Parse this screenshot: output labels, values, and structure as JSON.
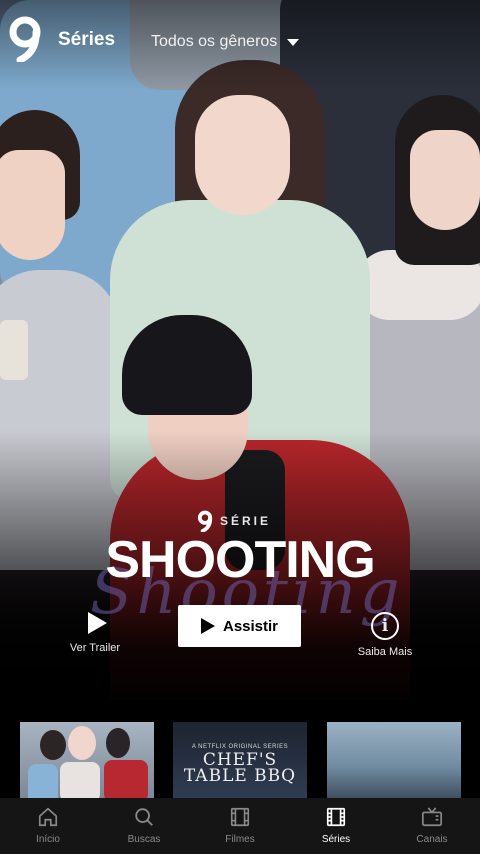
{
  "header": {
    "section_title": "Séries",
    "genre_filter": "Todos os gêneros"
  },
  "featured": {
    "tag": "SÉRIE",
    "title": "SHOOTING",
    "actions": {
      "trailer_label": "Ver Trailer",
      "watch_label": "Assistir",
      "info_label": "Saiba Mais"
    }
  },
  "thumbnails": [
    {
      "caption_small": "",
      "caption_big": ""
    },
    {
      "caption_small": "A NETFLIX ORIGINAL SERIES",
      "caption_big": "CHEF'S TABLE BBQ"
    },
    {
      "caption_small": "",
      "caption_big": ""
    }
  ],
  "nav": {
    "items": [
      {
        "label": "Início",
        "icon": "home-icon",
        "active": false
      },
      {
        "label": "Buscas",
        "icon": "search-icon",
        "active": false
      },
      {
        "label": "Filmes",
        "icon": "film-icon",
        "active": false
      },
      {
        "label": "Séries",
        "icon": "series-icon",
        "active": true
      },
      {
        "label": "Canais",
        "icon": "tv-icon",
        "active": false
      }
    ]
  },
  "colors": {
    "accent_active": "#ffffff",
    "nav_inactive": "#8a8a8a",
    "nav_bg": "#151515"
  }
}
